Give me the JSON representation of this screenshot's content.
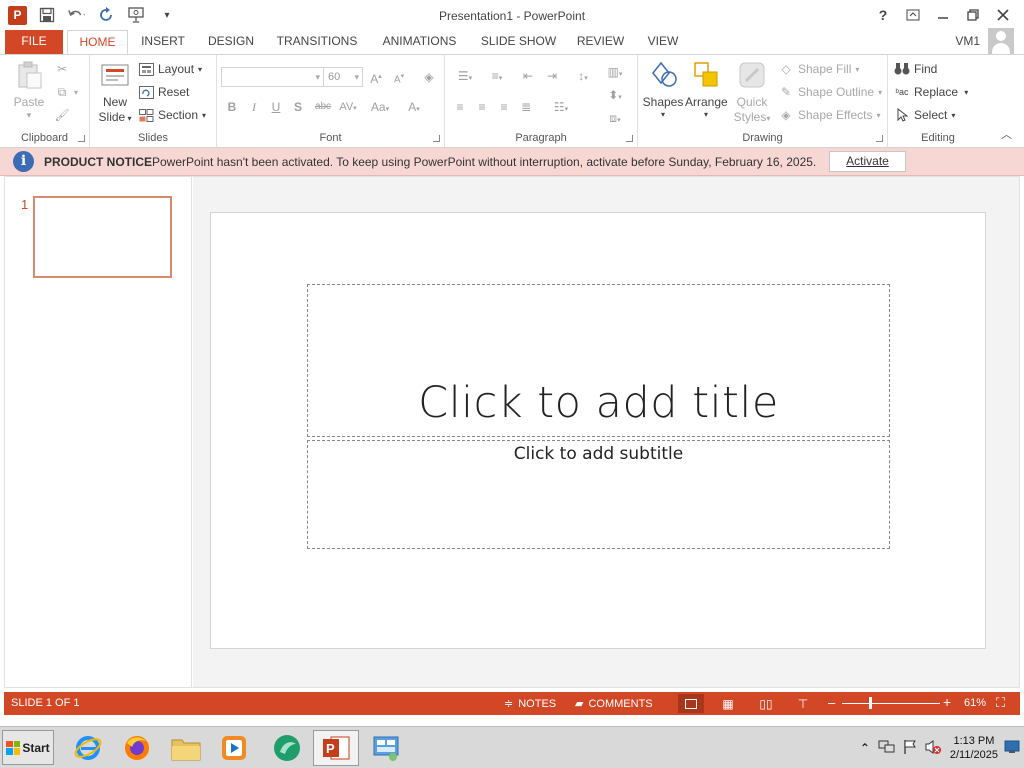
{
  "window": {
    "title": "Presentation1 - PowerPoint",
    "controls": {
      "help": "?",
      "ribbon_options": "⧉",
      "minimize": "—",
      "restore": "❐",
      "close": "✕"
    }
  },
  "qat": {
    "app_icon_letter": "P",
    "save": "💾",
    "undo": "↶",
    "redo": "↻",
    "present": "⎚",
    "customize": "▾"
  },
  "tabs": [
    "FILE",
    "HOME",
    "INSERT",
    "DESIGN",
    "TRANSITIONS",
    "ANIMATIONS",
    "SLIDE SHOW",
    "REVIEW",
    "VIEW"
  ],
  "active_tab": "HOME",
  "user": {
    "name": "VM1"
  },
  "ribbon": {
    "clipboard": {
      "label": "Clipboard",
      "paste": "Paste",
      "paste_arrow": "▾"
    },
    "slides": {
      "label": "Slides",
      "new_slide": "New",
      "new_slide_2": "Slide",
      "layout": "Layout",
      "reset": "Reset",
      "section": "Section"
    },
    "font": {
      "label": "Font",
      "font_name": "",
      "font_size": "60",
      "bold": "B",
      "italic": "I",
      "underline": "U",
      "shadow": "S",
      "strike": "abc",
      "spacing": "AV",
      "case": "Aa",
      "color": "A",
      "grow": "A",
      "shrink": "A"
    },
    "paragraph": {
      "label": "Paragraph"
    },
    "drawing": {
      "label": "Drawing",
      "shapes": "Shapes",
      "arrange": "Arrange",
      "quick_styles": "Quick",
      "quick_styles_2": "Styles",
      "shape_fill": "Shape Fill",
      "shape_outline": "Shape Outline",
      "shape_effects": "Shape Effects"
    },
    "editing": {
      "label": "Editing",
      "find": "Find",
      "replace": "Replace",
      "select": "Select"
    }
  },
  "notice": {
    "title": "PRODUCT NOTICE",
    "message": "PowerPoint hasn't been activated. To keep using PowerPoint without interruption, activate before Sunday, February 16, 2025.",
    "button": "Activate"
  },
  "thumbnails": {
    "slide_number": "1"
  },
  "slide": {
    "title_placeholder": "Click to add title",
    "subtitle_placeholder": "Click to add subtitle"
  },
  "status": {
    "slide_indicator": "SLIDE 1 OF 1",
    "notes": "NOTES",
    "comments": "COMMENTS",
    "zoom_out": "–",
    "zoom_in": "+",
    "zoom": "61%",
    "zoom_fraction": 0.61
  },
  "taskbar": {
    "start": "Start",
    "time": "1:13 PM",
    "date": "2/11/2025",
    "tray_expand": "⌃"
  },
  "colors": {
    "accent": "#d24726",
    "notice_bg": "#f7d7d4",
    "info_icon": "#3c6db4"
  }
}
